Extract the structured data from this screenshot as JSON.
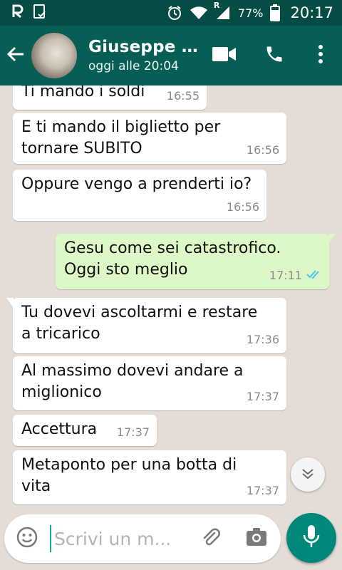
{
  "status_bar": {
    "battery": "77%",
    "network_badge": "R",
    "time": "20:17",
    "icons": [
      "r-logo-icon",
      "tablet-check-icon",
      "alarm-icon",
      "wifi-icon",
      "signal-icon",
      "battery-icon"
    ]
  },
  "header": {
    "contact_name": "Giuseppe A...",
    "last_seen": "oggi alle 20:04",
    "icons": [
      "back-arrow-icon",
      "video-call-icon",
      "phone-call-icon",
      "more-options-icon"
    ],
    "colors": {
      "bar": "#075e54",
      "status_bar": "#054d44"
    }
  },
  "messages": [
    {
      "dir": "in",
      "text": "Ti mando i soldi",
      "time": "16:55",
      "tail": false
    },
    {
      "dir": "in",
      "text": "E ti mando il biglietto per\ntornare SUBITO",
      "time": "16:56",
      "tail": false
    },
    {
      "dir": "in",
      "text": "Oppure vengo a prenderti io?",
      "time": "16:56",
      "tail": false
    },
    {
      "dir": "out",
      "text": "Gesu come sei catastrofico.\nOggi sto meglio",
      "time": "17:11",
      "read": true,
      "tail": true
    },
    {
      "dir": "in",
      "text": "Tu dovevi ascoltarmi e restare\na tricarico",
      "time": "17:36",
      "tail": true
    },
    {
      "dir": "in",
      "text": "Al massimo dovevi andare a\nmiglionico",
      "time": "17:37",
      "tail": false
    },
    {
      "dir": "in",
      "text": "Accettura",
      "time": "17:37",
      "tail": false
    },
    {
      "dir": "in",
      "text": "Metaponto per una botta di\nvita",
      "time": "17:37",
      "tail": false
    }
  ],
  "composer": {
    "placeholder": "Scrivi un m...",
    "icons": [
      "emoji-icon",
      "attach-icon",
      "camera-icon",
      "mic-icon",
      "chevron-down-icon"
    ],
    "accent": "#00897b"
  },
  "colors": {
    "incoming": "#ffffff",
    "outgoing": "#dcf8c6",
    "read_ticks": "#4fc3f7",
    "chat_bg": "#e5ddd5"
  }
}
